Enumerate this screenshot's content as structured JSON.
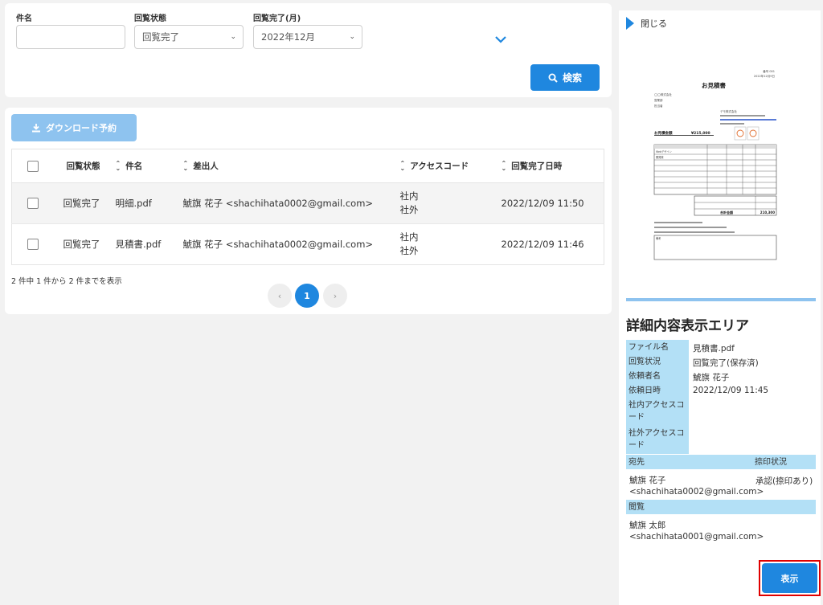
{
  "search": {
    "subject_label": "件名",
    "subject_value": "",
    "status_label": "回覧状態",
    "status_value": "回覧完了",
    "month_label": "回覧完了(月)",
    "month_value": "2022年12月",
    "search_button": "検索"
  },
  "list": {
    "download_button": "ダウンロード予約",
    "columns": [
      "回覧状態",
      "件名",
      "差出人",
      "アクセスコード",
      "回覧完了日時"
    ],
    "rows": [
      {
        "status": "回覧完了",
        "subject": "明細.pdf",
        "sender": "鯱旗 花子 <shachihata0002@gmail.com>",
        "code1": "社内",
        "code2": "社外",
        "date": "2022/12/09 11:50"
      },
      {
        "status": "回覧完了",
        "subject": "見積書.pdf",
        "sender": "鯱旗 花子 <shachihata0002@gmail.com>",
        "code1": "社内",
        "code2": "社外",
        "date": "2022/12/09 11:46"
      }
    ],
    "summary": "2 件中 1 件から 2 件までを表示",
    "pagination": {
      "prev": "‹",
      "current": "1",
      "next": "›"
    }
  },
  "side": {
    "close_label": "閉じる",
    "preview": {
      "title": "お見積書",
      "amount_label": "お見積金額",
      "amount_value": "¥215,000",
      "total_label": "合計金額",
      "total_value": "210,300",
      "top_right": "番号 001",
      "top_date": "2022年12月9日",
      "to_line1": "◯◯株式会社",
      "to_line2": "営業部",
      "to_line3": "担当者",
      "from_line1": "デモ株式会社",
      "note_label": "備考",
      "item1": "Webデザイン",
      "item2": "開発費"
    },
    "detail_title": "詳細内容表示エリア",
    "fields": [
      {
        "label": "ファイル名",
        "value": "見積書.pdf"
      },
      {
        "label": "回覧状況",
        "value": "回覧完了(保存済)"
      },
      {
        "label": "依頼者名",
        "value": "鯱旗 花子"
      },
      {
        "label": "依頼日時",
        "value": "2022/12/09 11:45"
      },
      {
        "label": "社内アクセスコード",
        "value": ""
      },
      {
        "label": "社外アクセスコード",
        "value": ""
      }
    ],
    "recipient_label": "宛先",
    "stamp_label": "捺印状況",
    "recipient_name": "鯱旗 花子",
    "recipient_email": "<shachihata0002@gmail.com>",
    "stamp_value": "承認(捺印あり)",
    "viewer_label": "閲覧",
    "viewer_name": "鯱旗 太郎",
    "viewer_email": "<shachihata0001@gmail.com>",
    "show_button": "表示"
  },
  "colors": {
    "accent": "#1f87df",
    "light_accent": "#8ec3ef",
    "label_bg": "#b3e0f6",
    "highlight": "#e00000"
  }
}
